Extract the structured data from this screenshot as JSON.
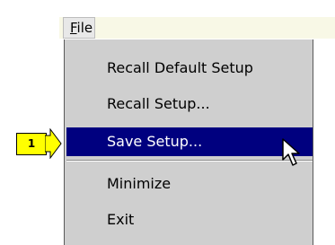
{
  "menubar": {
    "file_menu": {
      "label_mnemonic": "F",
      "label_rest": "ile"
    }
  },
  "dropdown": {
    "items": [
      {
        "label": "Recall Default Setup",
        "selected": false
      },
      {
        "label": "Recall Setup...",
        "selected": false
      },
      {
        "label": "Save Setup...",
        "selected": true
      },
      {
        "label": "Minimize",
        "selected": false
      },
      {
        "label": "Exit",
        "selected": false
      }
    ]
  },
  "callout": {
    "number": "1",
    "color": "#ffff00"
  },
  "colors": {
    "selection_bg": "#00007f",
    "menu_bg": "#cfcfcf"
  },
  "icons": {
    "cursor": "arrow-pointer-icon",
    "callout_arrow": "arrow-right-icon"
  }
}
